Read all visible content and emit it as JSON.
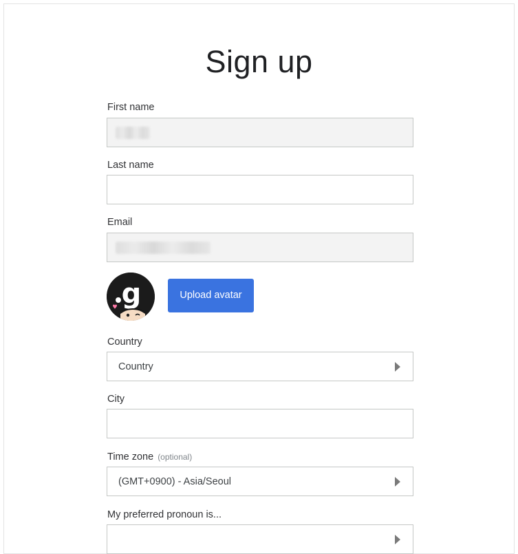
{
  "page": {
    "title": "Sign up"
  },
  "form": {
    "first_name": {
      "label": "First name",
      "value": ""
    },
    "last_name": {
      "label": "Last name",
      "value": ""
    },
    "email": {
      "label": "Email",
      "value": ""
    },
    "avatar": {
      "icon": "avatar-image",
      "upload_label": "Upload avatar",
      "button_color": "#3a73e0"
    },
    "country": {
      "label": "Country",
      "selected": "Country",
      "icon": "caret-right-icon"
    },
    "city": {
      "label": "City",
      "value": ""
    },
    "time_zone": {
      "label": "Time zone",
      "optional_label": "(optional)",
      "selected": "(GMT+0900) - Asia/Seoul",
      "icon": "caret-right-icon"
    },
    "pronoun": {
      "label": "My preferred pronoun is...",
      "selected": "",
      "icon": "caret-right-icon"
    }
  }
}
